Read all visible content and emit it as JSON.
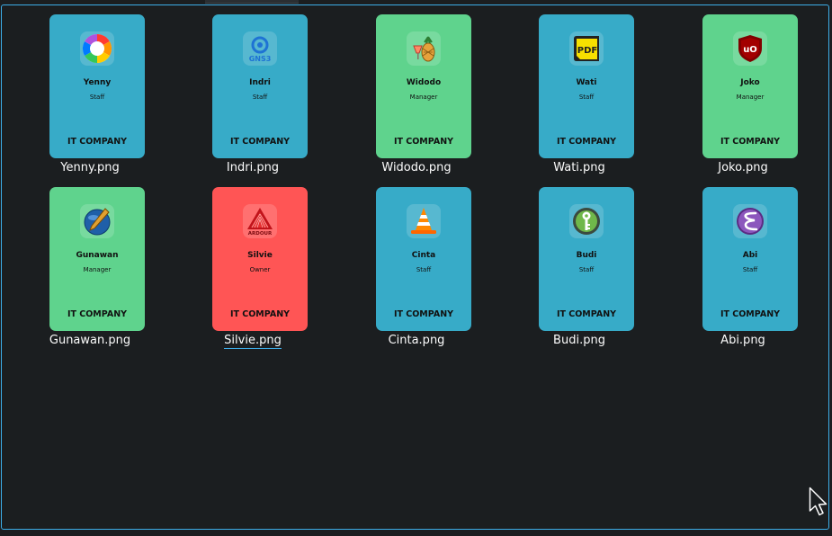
{
  "files": [
    {
      "filename": "Yenny.png",
      "name": "Yenny",
      "role": "Staff",
      "company": "IT COMPANY",
      "card_color": "#37abc8",
      "icon": "color-wheel-icon"
    },
    {
      "filename": "Indri.png",
      "name": "Indri",
      "role": "Staff",
      "company": "IT COMPANY",
      "card_color": "#37abc8",
      "icon": "gns3-icon"
    },
    {
      "filename": "Widodo.png",
      "name": "Widodo",
      "role": "Manager",
      "company": "IT COMPANY",
      "card_color": "#5fd38d",
      "icon": "pineapple-icon"
    },
    {
      "filename": "Wati.png",
      "name": "Wati",
      "role": "Staff",
      "company": "IT COMPANY",
      "card_color": "#37abc8",
      "icon": "pdf-icon"
    },
    {
      "filename": "Joko.png",
      "name": "Joko",
      "role": "Manager",
      "company": "IT COMPANY",
      "card_color": "#5fd38d",
      "icon": "ublock-shield-icon"
    },
    {
      "filename": "Gunawan.png",
      "name": "Gunawan",
      "role": "Manager",
      "company": "IT COMPANY",
      "card_color": "#5fd38d",
      "icon": "pen-orb-icon"
    },
    {
      "filename": "Silvie.png",
      "name": "Silvie",
      "role": "Owner",
      "company": "IT COMPANY",
      "card_color": "#ff5555",
      "icon": "ardour-icon",
      "selected": true
    },
    {
      "filename": "Cinta.png",
      "name": "Cinta",
      "role": "Staff",
      "company": "IT COMPANY",
      "card_color": "#37abc8",
      "icon": "vlc-cone-icon"
    },
    {
      "filename": "Budi.png",
      "name": "Budi",
      "role": "Staff",
      "company": "IT COMPANY",
      "card_color": "#37abc8",
      "icon": "keepassxc-key-icon"
    },
    {
      "filename": "Abi.png",
      "name": "Abi",
      "role": "Staff",
      "company": "IT COMPANY",
      "card_color": "#37abc8",
      "icon": "emacs-icon"
    }
  ],
  "icon_text": {
    "gns3": "GNS3",
    "pdf": "PDF",
    "ublock": "uO",
    "ardour": "ARDOUR"
  },
  "colors": {
    "background": "#1b1e20",
    "accent": "#3daee9",
    "staff": "#37abc8",
    "manager": "#5fd38d",
    "owner": "#ff5555",
    "label_text": "#fcfcfc"
  }
}
